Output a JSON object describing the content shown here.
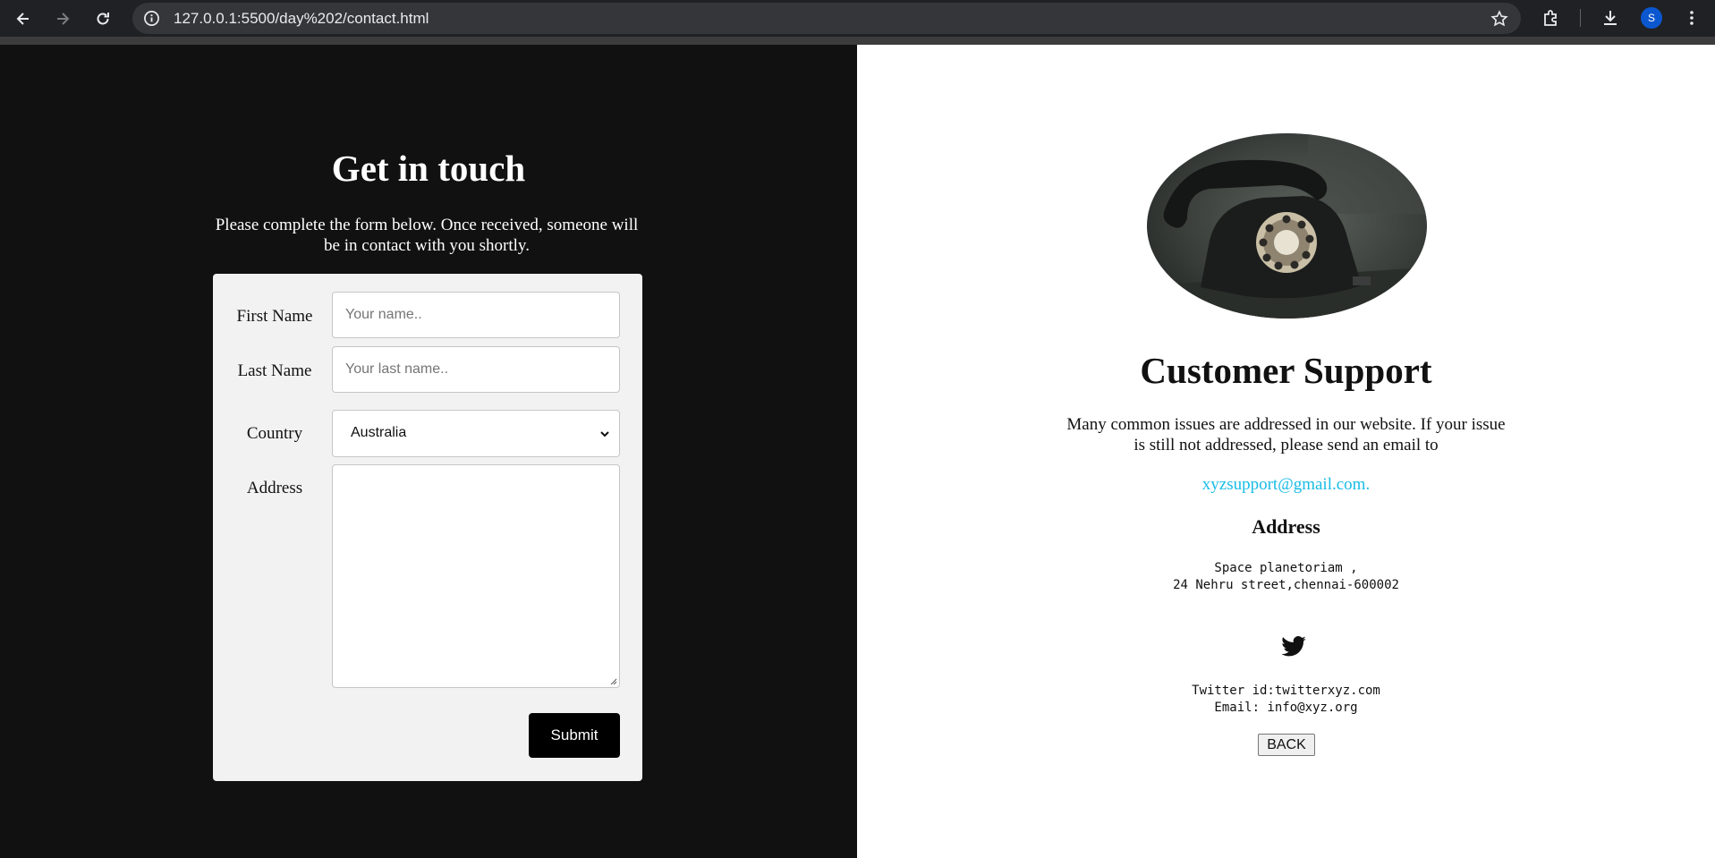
{
  "browser": {
    "url": "127.0.0.1:5500/day%202/contact.html",
    "profile_initial": "S",
    "icons": {
      "back": "arrow-left-icon",
      "forward": "arrow-right-icon",
      "reload": "reload-icon",
      "site_info": "info-icon",
      "bookmark": "star-icon",
      "extensions": "puzzle-icon",
      "downloads": "download-icon",
      "menu": "kebab-menu-icon"
    }
  },
  "contact_form": {
    "title": "Get in touch",
    "subtitle": "Please complete the form below. Once received, someone will be in contact with you shortly.",
    "first_name": {
      "label": "First Name",
      "value": "",
      "placeholder": "Your name.."
    },
    "last_name": {
      "label": "Last Name",
      "value": "",
      "placeholder": "Your last name.."
    },
    "country": {
      "label": "Country",
      "selected": "Australia"
    },
    "address": {
      "label": "Address",
      "value": ""
    },
    "submit_label": "Submit"
  },
  "support": {
    "image": "rotary-telephone-photo",
    "title": "Customer Support",
    "text": "Many common issues are addressed in our website. If your issue is still not addressed, please send an email to",
    "email": "xyzsupport@gmail.com.",
    "address_heading": "Address",
    "address_lines": "Space planetoriam ,\n24 Nehru street,chennai-600002",
    "social_icon": "twitter-bird-icon",
    "contact_lines": "Twitter id:twitterxyz.com\nEmail: info@xyz.org",
    "back_label": "BACK"
  },
  "colors": {
    "left_background": "#111111",
    "card_background": "#f2f2f2",
    "submit_background": "#000000",
    "link": "#18bce5"
  }
}
